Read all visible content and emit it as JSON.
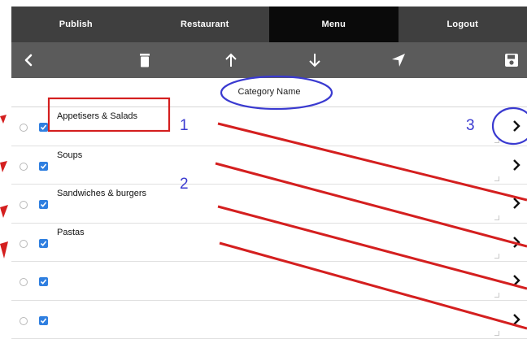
{
  "nav": {
    "tabs": [
      {
        "label": "Publish",
        "active": false
      },
      {
        "label": "Restaurant",
        "active": false
      },
      {
        "label": "Menu",
        "active": true
      },
      {
        "label": "Logout",
        "active": false
      }
    ]
  },
  "toolbar": {
    "icons": [
      "back-chevron-icon",
      "trash-icon",
      "arrow-up-icon",
      "arrow-down-icon",
      "send-icon",
      "save-icon"
    ]
  },
  "header": {
    "category_label": "Category Name"
  },
  "categories": [
    {
      "name": "Appetisers & Salads",
      "checked": true
    },
    {
      "name": "Soups",
      "checked": true
    },
    {
      "name": "Sandwiches & burgers",
      "checked": true
    },
    {
      "name": "Pastas",
      "checked": true
    },
    {
      "name": "",
      "checked": true
    },
    {
      "name": "",
      "checked": true
    }
  ],
  "annotations": {
    "n1": "1",
    "n2": "2",
    "n3": "3",
    "ink_color": "#d41f1f",
    "circle_color": "#3a3ad0"
  },
  "colors": {
    "nav_bg": "#3f3f3f",
    "nav_active": "#0a0a0a",
    "toolbar_bg": "#5b5b5b",
    "checkbox": "#2f7fe0"
  }
}
